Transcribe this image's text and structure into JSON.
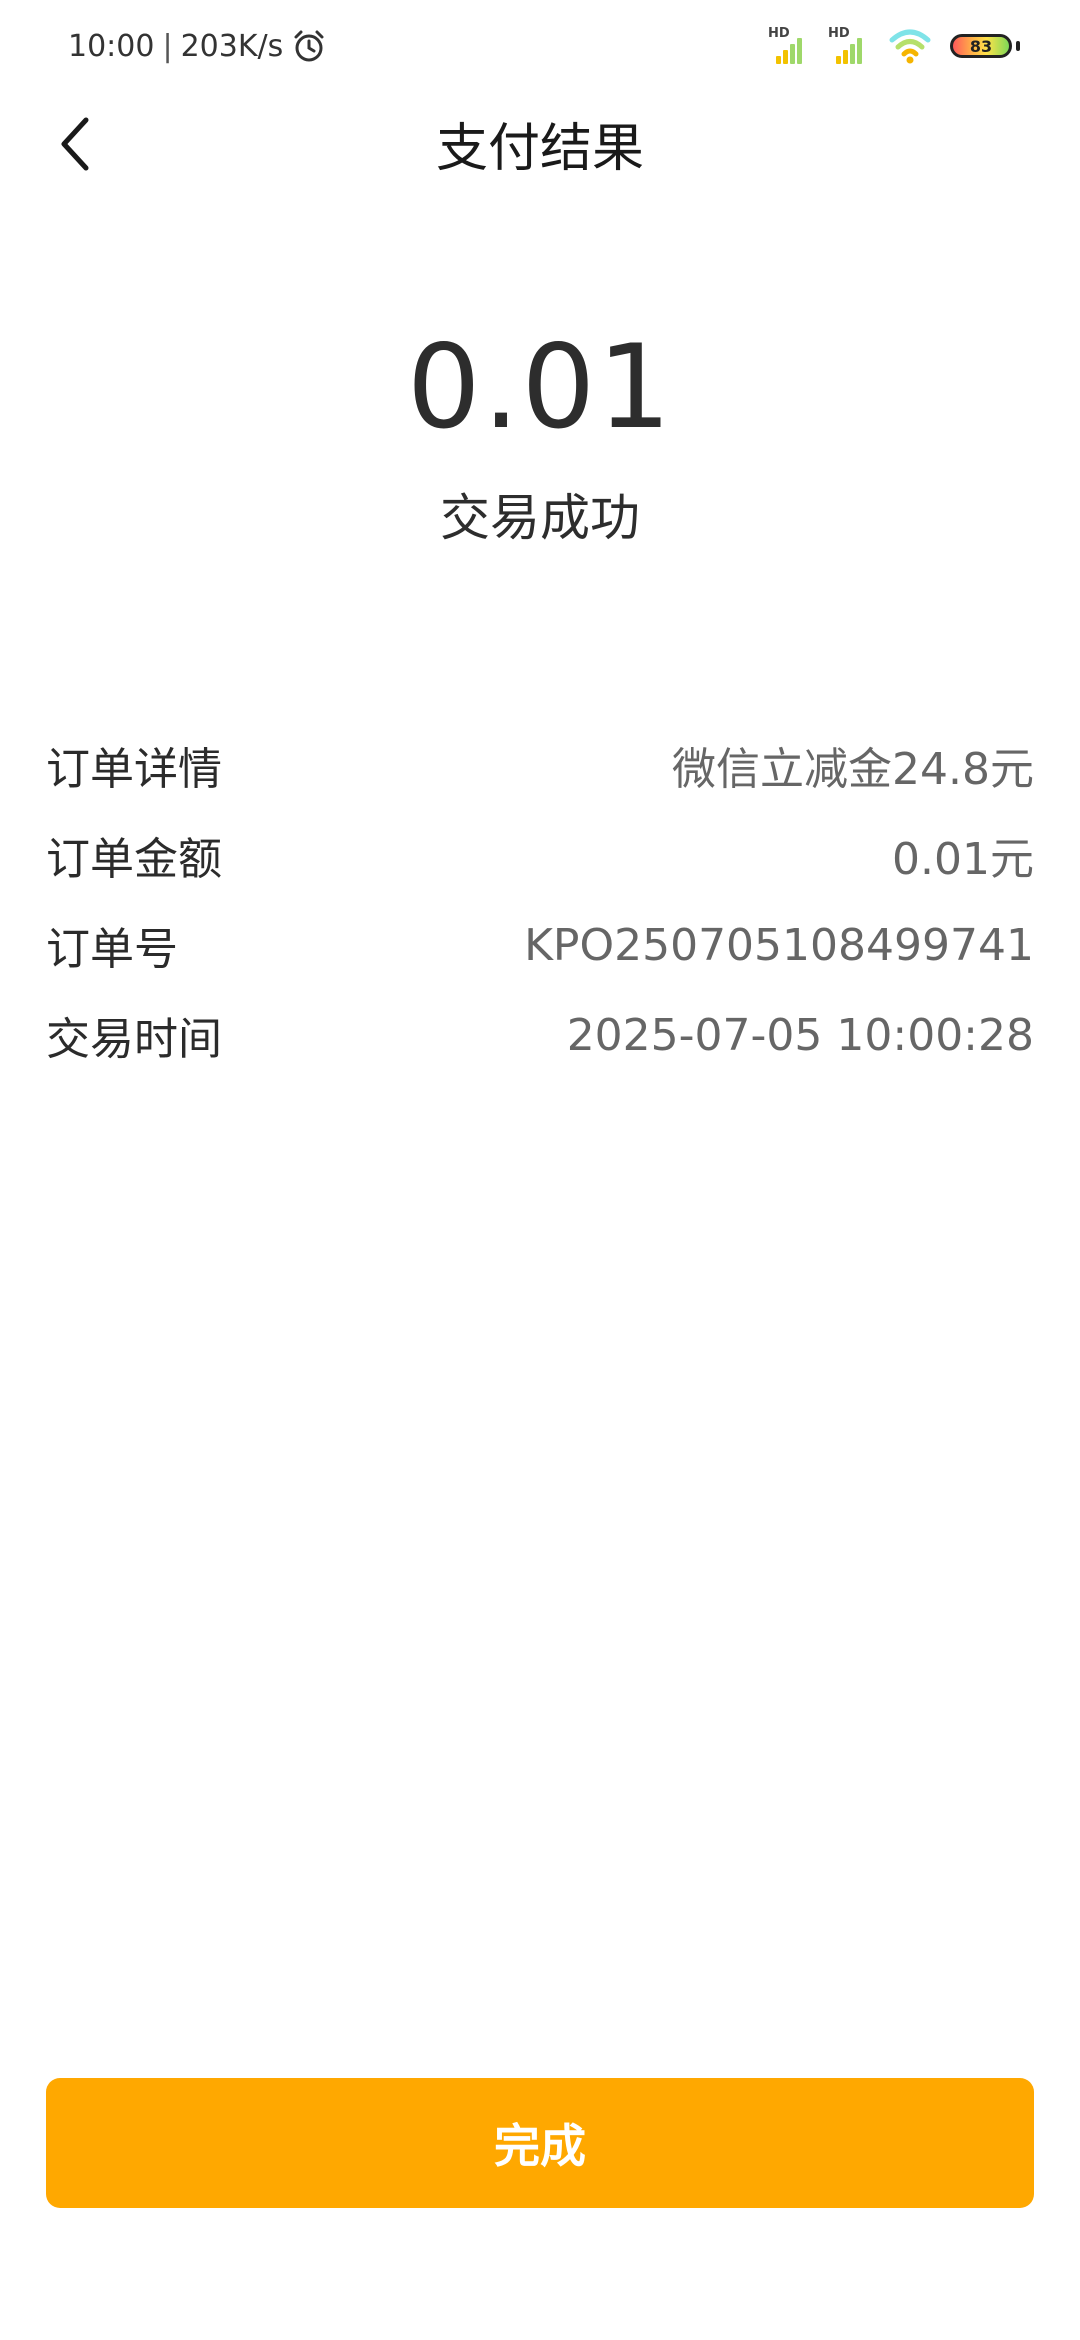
{
  "status_bar": {
    "time": "10:00",
    "separator": "|",
    "speed": "203K/s",
    "hd_label": "HD",
    "battery_level": "83",
    "icons": [
      "alarm-clock-icon",
      "signal-hd-icon",
      "wifi-icon",
      "battery-icon"
    ]
  },
  "header": {
    "title": "支付结果",
    "back_icon": "chevron-left-icon"
  },
  "result": {
    "amount": "0.01",
    "status": "交易成功"
  },
  "details": [
    {
      "label": "订单详情",
      "value": "微信立减金24.8元"
    },
    {
      "label": "订单金额",
      "value": "0.01元"
    },
    {
      "label": "订单号",
      "value": "KPO250705108499741"
    },
    {
      "label": "交易时间",
      "value": "2025-07-05 10:00:28"
    }
  ],
  "footer": {
    "done_label": "完成"
  },
  "colors": {
    "accent": "#FFA800",
    "text_primary": "#2b2b2b",
    "text_secondary": "#666666",
    "background": "#ffffff"
  }
}
